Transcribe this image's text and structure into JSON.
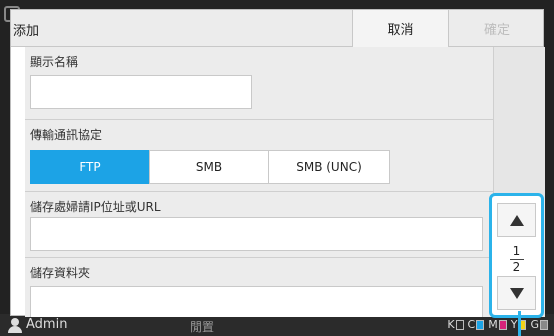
{
  "dialog": {
    "title": "添加",
    "cancel_label": "取消",
    "ok_label": "確定"
  },
  "fields": {
    "display_name_label": "顯示名稱",
    "protocol_label": "傳輸通訊協定",
    "protocol_options": [
      "FTP",
      "SMB",
      "SMB (UNC)"
    ],
    "protocol_selected": "FTP",
    "server_label": "儲存處婦請IP位址或URL",
    "folder_label": "儲存資料夾"
  },
  "pager": {
    "current": "1",
    "total": "2"
  },
  "statusbar": {
    "user": "Admin",
    "mid": "閒置",
    "inks": [
      "K",
      "C",
      "M",
      "Y",
      "G"
    ]
  },
  "colors": {
    "accent": "#1ca3e6",
    "highlight": "#2bb3ea"
  }
}
